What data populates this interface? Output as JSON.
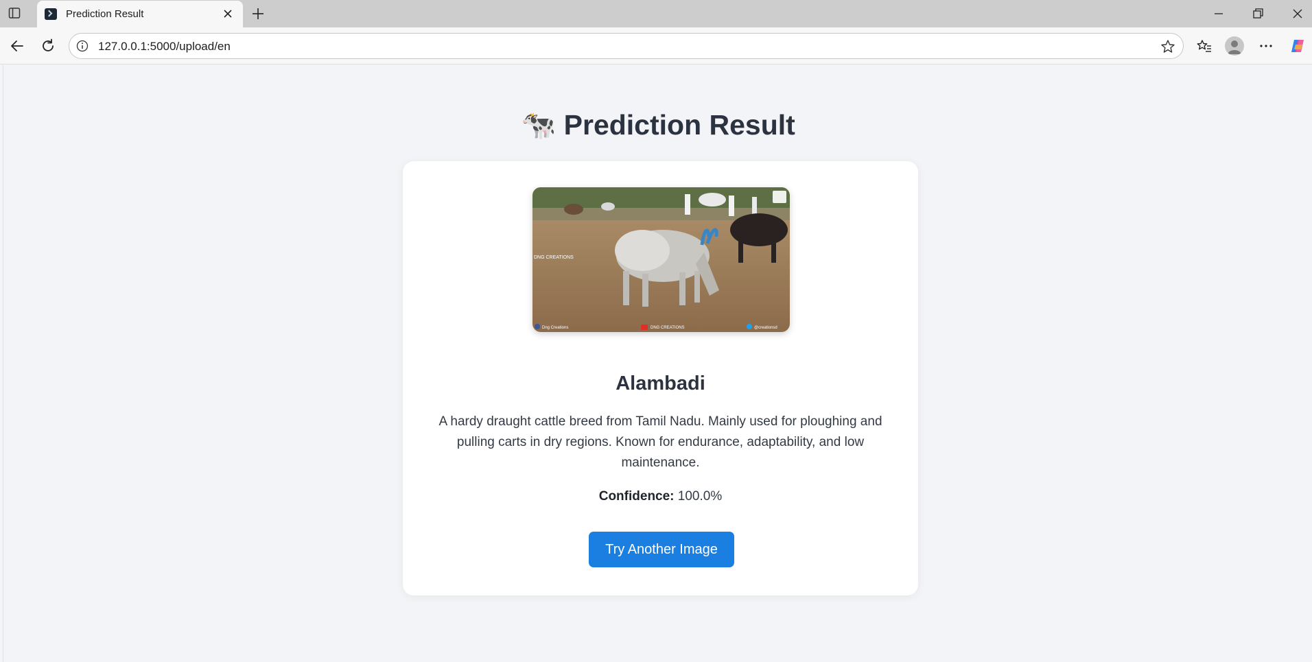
{
  "browser": {
    "tab_title": "Prediction Result",
    "url": "127.0.0.1:5000/upload/en"
  },
  "page": {
    "heading_emoji": "🐄",
    "heading": "Prediction Result",
    "image_watermarks": {
      "center": "DNG CREATIONS",
      "bottom_left": "Dng Creations",
      "bottom_center": "DNG CREATIONS",
      "bottom_right": "@creationsd"
    },
    "breed": "Alambadi",
    "description": "A hardy draught cattle breed from Tamil Nadu. Mainly used for ploughing and pulling carts in dry regions. Known for endurance, adaptability, and low maintenance.",
    "confidence_label": "Confidence:",
    "confidence_value": "100.0%",
    "button_label": "Try Another Image"
  },
  "colors": {
    "accent": "#1a7fe0",
    "page_bg": "#f3f4f7",
    "text": "#2c3340"
  }
}
